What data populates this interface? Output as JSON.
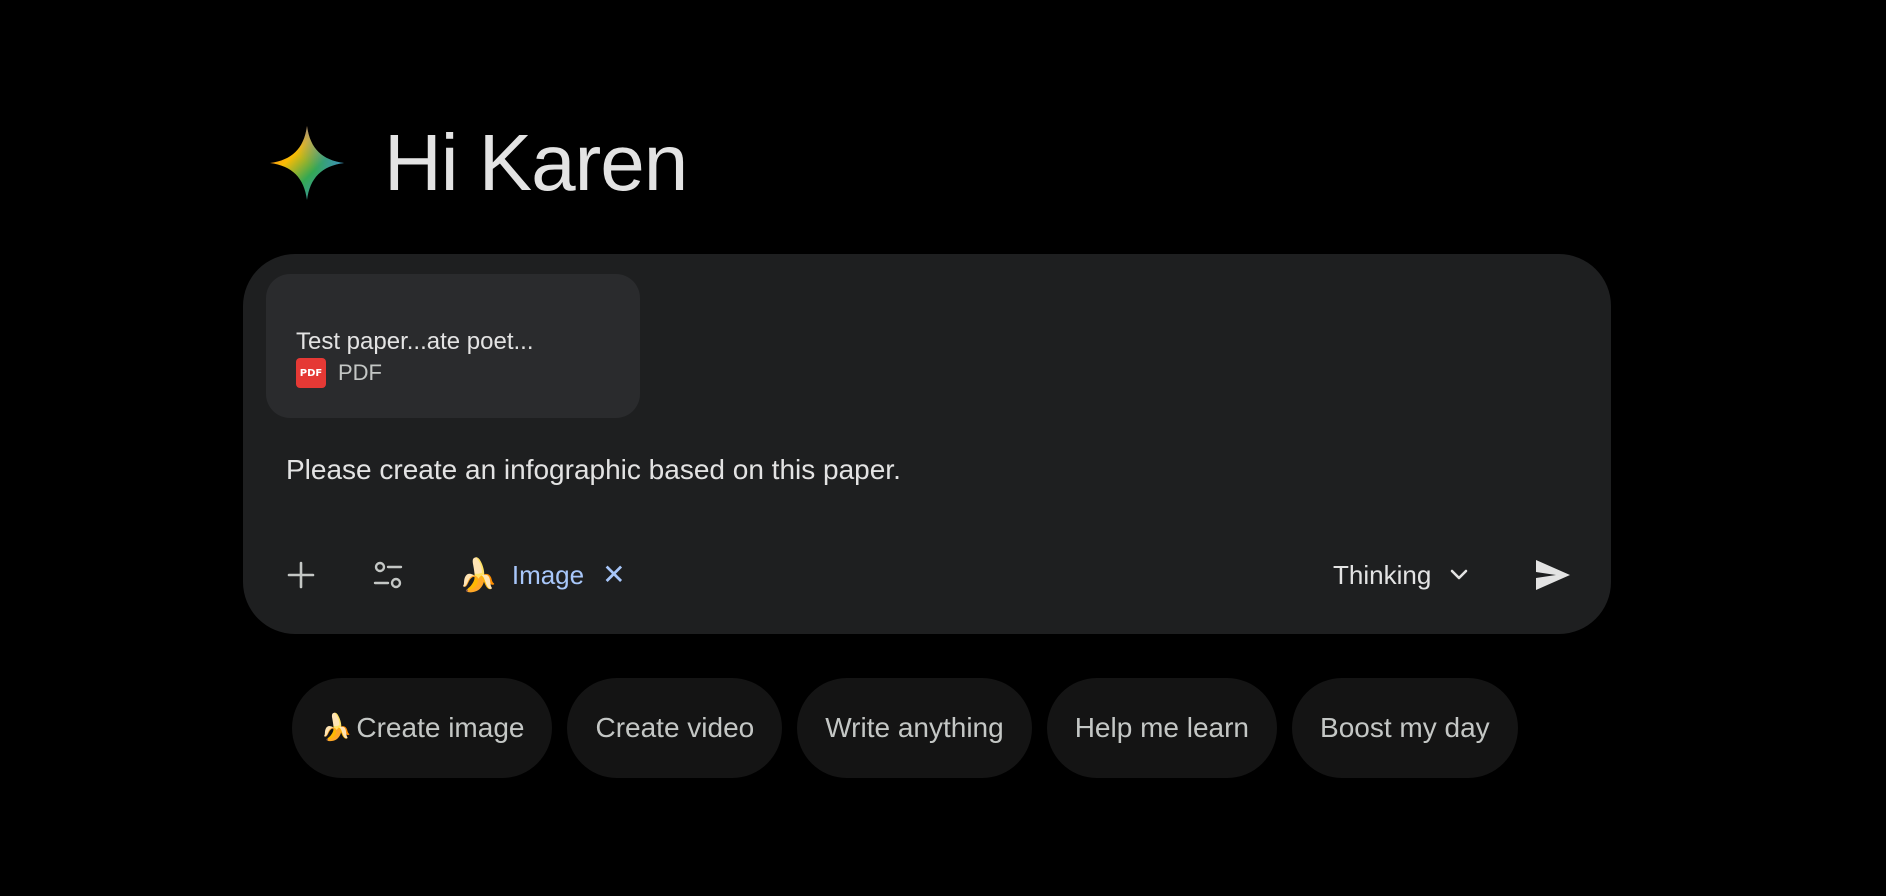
{
  "greeting": {
    "text": "Hi Karen",
    "logo_icon": "gemini-spark-icon"
  },
  "composer": {
    "attachment": {
      "title": "Test paper...ate poet...",
      "type_label": "PDF",
      "type_icon": "pdf-icon",
      "icon_text": "PDF"
    },
    "prompt": "Please create an infographic based on this paper.",
    "toolbar": {
      "add_icon": "plus-icon",
      "tools_icon": "tools-sliders-icon",
      "image_chip": {
        "emoji": "🍌",
        "label": "Image",
        "close": "✕"
      },
      "mode": {
        "label": "Thinking",
        "icon": "chevron-down-icon"
      },
      "send_icon": "send-icon"
    }
  },
  "suggestions": [
    {
      "emoji": "🍌",
      "label": "Create image"
    },
    {
      "emoji": "",
      "label": "Create video"
    },
    {
      "emoji": "",
      "label": "Write anything"
    },
    {
      "emoji": "",
      "label": "Help me learn"
    },
    {
      "emoji": "",
      "label": "Boost my day"
    }
  ],
  "colors": {
    "background": "#000000",
    "composer_bg": "#1e1f20",
    "attachment_bg": "#2a2b2d",
    "chip_accent": "#a8c7fa",
    "suggestion_bg": "#141414",
    "pdf_red": "#e53935"
  }
}
